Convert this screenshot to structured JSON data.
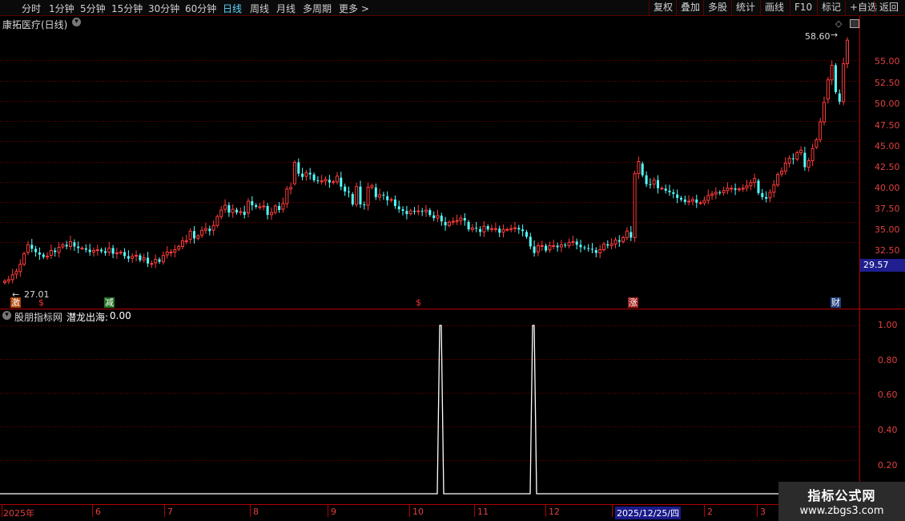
{
  "toolbar": {
    "periods": [
      "分时",
      "1分钟",
      "5分钟",
      "15分钟",
      "30分钟",
      "60分钟",
      "日线",
      "周线",
      "月线",
      "多周期",
      "更多 >"
    ],
    "active_period": "日线",
    "actions": [
      "复权",
      "叠加",
      "多股",
      "统计",
      "画线",
      "F10",
      "标记",
      "+自选",
      "返回"
    ]
  },
  "main_chart": {
    "title": "康拓医疗(日线)",
    "high_label": "58.60",
    "low_label": "27.01",
    "last_price": "29.57",
    "y_ticks": [
      "55.00",
      "52.50",
      "50.00",
      "47.50",
      "45.00",
      "42.50",
      "40.00",
      "37.50",
      "35.00",
      "32.50"
    ],
    "markers": [
      {
        "text": "激",
        "color": "#ffffff",
        "bg": "#b04000"
      },
      {
        "text": "$",
        "color": "#ff3030",
        "bg": ""
      },
      {
        "text": "减",
        "color": "#ffffff",
        "bg": "#207020"
      },
      {
        "text": "$",
        "color": "#ff3030",
        "bg": ""
      },
      {
        "text": "涨",
        "color": "#ffffff",
        "bg": "#a02020"
      },
      {
        "text": "财",
        "color": "#ffffff",
        "bg": "#204080"
      }
    ],
    "colors": {
      "up": "#ff3b3b",
      "down": "#54ffff",
      "grid": "#7a0000",
      "axis": "#b00000"
    }
  },
  "sub_chart": {
    "source": "股朋指标网",
    "indicator_name": "潜龙出海:",
    "indicator_value": "0.00",
    "y_ticks": [
      "1.00",
      "0.80",
      "0.60",
      "0.40",
      "0.20"
    ],
    "spikes": [
      {
        "index": 137,
        "value": 1.0
      },
      {
        "index": 165,
        "value": 1.0
      }
    ]
  },
  "x_axis": {
    "labels": [
      "2025年",
      "6",
      "7",
      "8",
      "9",
      "10",
      "11",
      "12",
      "2025/12/25/四",
      "2",
      "3"
    ]
  },
  "watermark": {
    "line1": "指标公式网",
    "line2": "www.zbgs3.com"
  },
  "chart_data": {
    "type": "candlestick",
    "title": "康拓医疗(日线)",
    "ylim": [
      26.0,
      59.5
    ],
    "y_ticks": [
      32.5,
      35.0,
      37.5,
      40.0,
      42.5,
      45.0,
      47.5,
      50.0,
      52.5,
      55.0
    ],
    "series": [
      {
        "name": "close",
        "values": [
          27.7,
          27.9,
          28.5,
          28.9,
          29.8,
          31.1,
          32.2,
          31.7,
          31.3,
          31.0,
          30.7,
          30.8,
          31.5,
          31.3,
          31.9,
          32.2,
          32.0,
          32.6,
          32.0,
          31.8,
          31.8,
          31.6,
          31.3,
          31.5,
          31.6,
          31.4,
          31.2,
          31.8,
          31.1,
          31.2,
          31.3,
          30.8,
          30.5,
          30.8,
          30.9,
          30.3,
          30.6,
          29.9,
          29.9,
          30.4,
          30.1,
          30.9,
          31.3,
          31.3,
          31.6,
          32.0,
          32.7,
          32.7,
          33.9,
          33.0,
          33.3,
          34.0,
          34.2,
          33.9,
          34.6,
          35.7,
          36.5,
          37.1,
          36.2,
          36.6,
          36.2,
          36.3,
          35.9,
          37.6,
          37.1,
          36.9,
          36.9,
          37.0,
          35.9,
          36.2,
          37.0,
          36.5,
          37.3,
          39.1,
          39.3,
          42.4,
          41.0,
          40.6,
          41.1,
          40.9,
          40.2,
          40.1,
          40.1,
          40.3,
          39.9,
          40.0,
          40.7,
          39.4,
          38.8,
          38.7,
          37.2,
          39.4,
          37.2,
          37.1,
          39.3,
          39.5,
          38.1,
          38.4,
          38.3,
          37.7,
          37.8,
          37.0,
          36.6,
          36.4,
          36.0,
          36.4,
          36.3,
          36.4,
          36.3,
          36.5,
          35.9,
          35.5,
          35.8,
          35.1,
          34.6,
          35.0,
          35.1,
          35.2,
          35.5,
          35.2,
          34.1,
          34.3,
          34.2,
          33.8,
          34.5,
          34.1,
          34.2,
          34.2,
          33.7,
          34.1,
          34.1,
          34.2,
          34.3,
          34.1,
          33.9,
          33.2,
          32.0,
          31.2,
          32.1,
          32.1,
          31.5,
          32.1,
          32.1,
          31.9,
          32.2,
          32.1,
          32.5,
          32.6,
          32.2,
          31.9,
          31.8,
          31.7,
          31.6,
          31.2,
          31.6,
          32.3,
          32.1,
          32.3,
          32.8,
          32.6,
          33.1,
          33.9,
          33.1,
          41.0,
          42.5,
          40.8,
          39.7,
          39.6,
          40.2,
          39.2,
          39.2,
          38.9,
          38.7,
          38.5,
          38.0,
          37.8,
          37.5,
          37.6,
          37.8,
          37.4,
          37.4,
          37.7,
          38.3,
          38.5,
          38.7,
          38.6,
          38.9,
          39.2,
          39.2,
          39.0,
          39.1,
          39.2,
          39.5,
          39.9,
          40.4,
          38.6,
          38.1,
          37.9,
          38.7,
          39.6,
          40.9,
          41.3,
          42.3,
          42.9,
          42.8,
          43.6,
          43.9,
          41.8,
          42.6,
          44.1,
          45.2,
          47.4,
          49.8,
          52.6,
          54.4,
          51.1,
          49.9,
          54.6,
          57.5
        ]
      }
    ],
    "indicator": {
      "name": "潜龙出海",
      "ylim": [
        0,
        1.0
      ],
      "nonzero_bars": [
        {
          "index": 137,
          "value": 1.0
        },
        {
          "index": 165,
          "value": 1.0
        }
      ]
    }
  }
}
